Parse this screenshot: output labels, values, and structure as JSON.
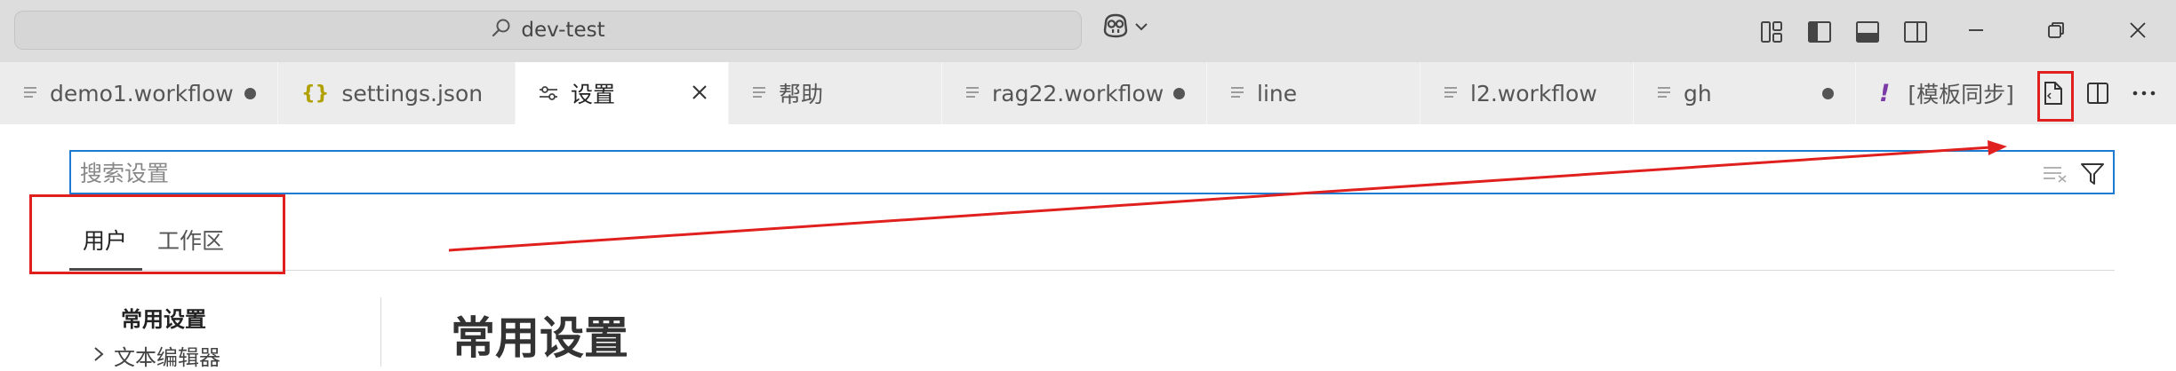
{
  "titlebar": {
    "command_center_text": "dev-test",
    "copilot_icon": "copilot-icon",
    "layout_icons": [
      "customize-layout-icon",
      "toggle-primary-sidebar-icon",
      "toggle-panel-icon",
      "toggle-secondary-sidebar-icon"
    ],
    "window_controls": [
      "minimize-icon",
      "restore-icon",
      "close-icon"
    ]
  },
  "tabs": [
    {
      "label": "demo1.workflow",
      "icon": "file-lines-icon",
      "dirty": true
    },
    {
      "label": "settings.json",
      "icon": "json-braces-icon",
      "icon_text": "{}",
      "dirty": false
    },
    {
      "label": "设置",
      "icon": "settings-sliders-icon",
      "active": true,
      "close": true
    },
    {
      "label": "帮助",
      "icon": "file-lines-icon",
      "dirty": false
    },
    {
      "label": "rag22.workflow",
      "icon": "file-lines-icon",
      "dirty": true
    },
    {
      "label": "line",
      "icon": "file-lines-icon",
      "dirty": false
    },
    {
      "label": "l2.workflow",
      "icon": "file-lines-icon",
      "dirty": false
    },
    {
      "label": "gh",
      "icon": "file-lines-icon",
      "dirty": true
    },
    {
      "label": "[模板同步]",
      "icon": "exclamation-icon",
      "icon_text": "!",
      "dirty": false
    }
  ],
  "editor_actions": [
    "open-settings-json-icon",
    "split-editor-icon",
    "more-actions-icon"
  ],
  "settings": {
    "search_placeholder": "搜索设置",
    "scope_tabs": [
      "用户",
      "工作区"
    ],
    "toc": [
      {
        "label": "常用设置",
        "bold": true
      },
      {
        "label": "文本编辑器",
        "collapsed": true
      }
    ],
    "section_title": "常用设置"
  },
  "colors": {
    "titlebar_bg": "#dddddd",
    "tabbar_bg": "#ececec",
    "focus_border": "#1f7ad1",
    "annotation_red": "#e0201e"
  }
}
